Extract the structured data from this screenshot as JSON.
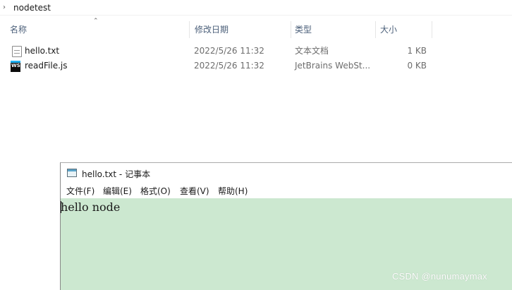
{
  "explorer": {
    "breadcrumb": "nodetest",
    "columns": {
      "name": "名称",
      "modified": "修改日期",
      "type": "类型",
      "size": "大小"
    },
    "files": [
      {
        "name": "hello.txt",
        "modified": "2022/5/26 11:32",
        "type": "文本文档",
        "size": "1 KB",
        "icon": "text-file-icon"
      },
      {
        "name": "readFile.js",
        "modified": "2022/5/26 11:32",
        "type": "JetBrains WebSt...",
        "size": "0 KB",
        "icon": "webstorm-file-icon"
      }
    ]
  },
  "notepad": {
    "title": "hello.txt - 记事本",
    "menu": [
      "文件(F)",
      "编辑(E)",
      "格式(O)",
      "查看(V)",
      "帮助(H)"
    ],
    "content": "hello node",
    "background_color": "#cce8d0"
  },
  "watermark": "CSDN @nunumaymax"
}
